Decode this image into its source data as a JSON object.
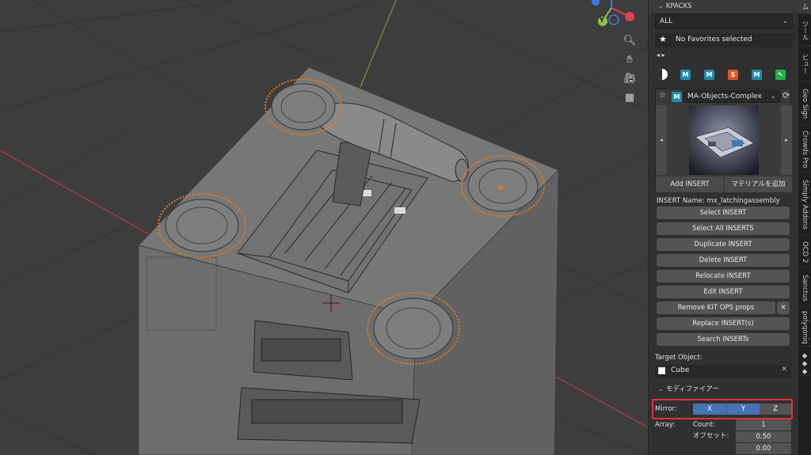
{
  "panel": {
    "header_title": "KPACKS",
    "filter_value": "ALL",
    "favorites_text": "No Favorites selected",
    "insert_pack": "MA-Objects-Complex",
    "add_insert": "Add INSERT",
    "add_material": "マテリアルを追加",
    "insert_name": "INSERT Name: mx_latchingassembly",
    "buttons": [
      "Select INSERT",
      "Select All INSERTS",
      "Duplicate INSERT",
      "Delete INSERT",
      "Relocate INSERT",
      "Edit INSERT",
      "Remove KIT OPS props",
      "Replace INSERT(s)",
      "Search INSERTs"
    ],
    "target_label": "Target Object:",
    "target_value": "Cube",
    "modifier_title": "モディファイアー",
    "mirror_label": "Mirror:",
    "mirror_axes": [
      "X",
      "Y",
      "Z"
    ],
    "array_label": "Array:",
    "count_label": "Count:",
    "count_value": "1",
    "offset_label": "オフセット:",
    "offset_value": "0.50",
    "offset_value2": "0.00"
  },
  "pack_icons": [
    {
      "glyph": "M",
      "color": "#1f8ea8"
    },
    {
      "glyph": "M",
      "color": "#1f8ea8"
    },
    {
      "glyph": "S",
      "color": "#e05522"
    },
    {
      "glyph": "M",
      "color": "#1f8ea8"
    },
    {
      "glyph": "↖",
      "color": "#22b14c"
    }
  ],
  "tabs": [
    "ツール",
    "ビュー",
    "Geo Sign",
    "Crowds Pro",
    "Simply Addons",
    "OCD 2",
    "Sanctus",
    "polyqoniq"
  ],
  "gizmo": {
    "y_label": "Y",
    "x_color": "#e0405a",
    "y_color": "#8bc34a",
    "z_color": "#3b7be0"
  },
  "accents": {
    "highlight_box": "#e03040",
    "mirror_active": "#4772b3"
  }
}
